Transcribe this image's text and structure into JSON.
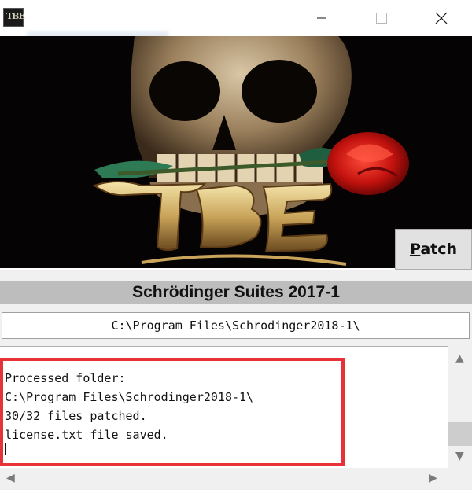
{
  "window": {
    "icon_label": "TBE",
    "controls": {
      "minimize": "minimize",
      "maximize": "maximize",
      "close": "close"
    }
  },
  "banner": {
    "logo_text": "TBE",
    "patch_label_first": "P",
    "patch_label_rest": "atch"
  },
  "product": {
    "title": "Schrödinger Suites 2017-1"
  },
  "path": {
    "value": "C:\\Program Files\\Schrodinger2018-1\\"
  },
  "log": {
    "lines": [
      "Processed folder:",
      "C:\\Program Files\\Schrodinger2018-1\\",
      "30/32 files patched.",
      "license.txt file saved."
    ]
  },
  "colors": {
    "highlight": "#e8323a",
    "product_bar": "#bdbdbd",
    "button": "#e1e1e1"
  },
  "icons": [
    "app-icon",
    "minimize-icon",
    "maximize-icon",
    "close-icon",
    "scroll-up-icon",
    "scroll-down-icon",
    "scroll-left-icon",
    "scroll-right-icon"
  ]
}
